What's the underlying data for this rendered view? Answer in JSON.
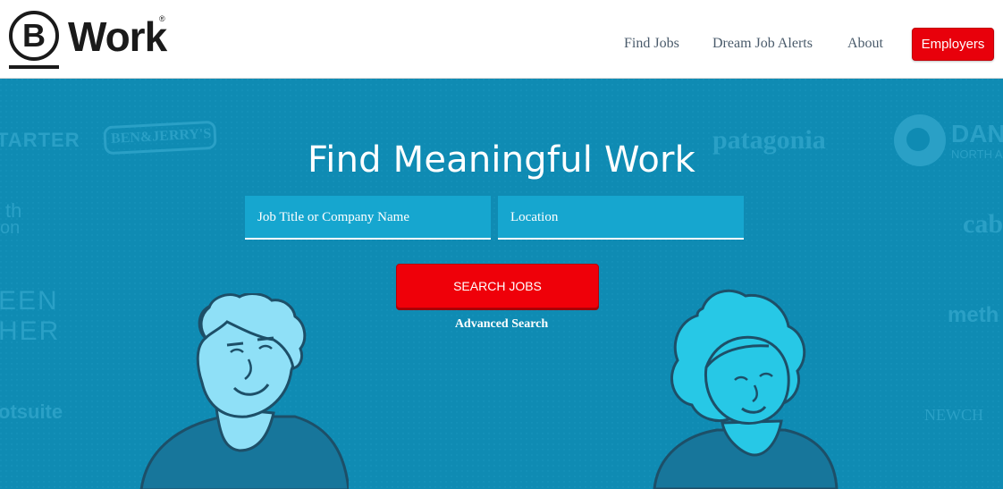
{
  "brand": {
    "logo_letter": "B",
    "logo_word": "Work",
    "logo_reg": "®"
  },
  "nav": {
    "find_jobs": "Find Jobs",
    "dream_job_alerts": "Dream Job Alerts",
    "about": "About",
    "employers": "Employers"
  },
  "hero": {
    "title": "Find Meaningful Work",
    "job_placeholder": "Job Title or Company Name",
    "location_placeholder": "Location",
    "search_button": "SEARCH JOBS",
    "advanced_search": "Advanced Search"
  },
  "background_brands": {
    "starter": "TARTER",
    "benjerrys": "BEN&JERRY'S",
    "patagonia": "patagonia",
    "danone_1": "DAN",
    "danone_2": "NORTH A",
    "earth_1": "th",
    "earth_2": "on",
    "green_1": "EEN",
    "green_2": "HER",
    "hootsuite": "otsuite",
    "cabot": "cab",
    "method": "meth",
    "newchapter": "NEWCH"
  },
  "colors": {
    "hero_bg": "#0f8bb3",
    "accent_red": "#e8000b",
    "field_bg": "#16a6cf",
    "illustration_light": "#8fe0f7",
    "illustration_cyan": "#27c8e6"
  }
}
